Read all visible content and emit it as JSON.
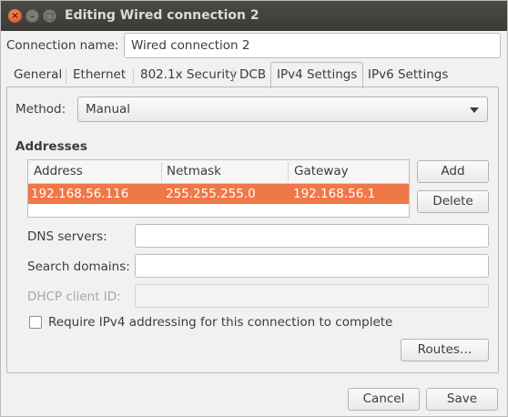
{
  "window": {
    "title": "Editing Wired connection 2",
    "controls": {
      "close": "×",
      "minimize": "–",
      "maximize": "□"
    }
  },
  "connection_name": {
    "label": "Connection name:",
    "value": "Wired connection 2"
  },
  "tabs": [
    {
      "label": "General"
    },
    {
      "label": "Ethernet"
    },
    {
      "label": "802.1x Security"
    },
    {
      "label": "DCB"
    },
    {
      "label": "IPv4 Settings",
      "active": true
    },
    {
      "label": "IPv6 Settings"
    }
  ],
  "method": {
    "label": "Method:",
    "value": "Manual"
  },
  "addresses": {
    "heading": "Addresses",
    "columns": [
      "Address",
      "Netmask",
      "Gateway"
    ],
    "rows": [
      {
        "address": "192.168.56.116",
        "netmask": "255.255.255.0",
        "gateway": "192.168.56.1",
        "selected": true
      }
    ],
    "add_label": "Add",
    "delete_label": "Delete"
  },
  "dns": {
    "label": "DNS servers:",
    "value": ""
  },
  "search_domains": {
    "label": "Search domains:",
    "value": ""
  },
  "dhcp_client_id": {
    "label": "DHCP client ID:",
    "value": "",
    "disabled": true
  },
  "require_ipv4": {
    "label": "Require IPv4 addressing for this connection to complete",
    "checked": false
  },
  "routes_label": "Routes…",
  "footer": {
    "cancel_label": "Cancel",
    "save_label": "Save"
  },
  "colors": {
    "accent": "#f07746",
    "titlebar": "#3c3b37",
    "close": "#df4a16"
  }
}
